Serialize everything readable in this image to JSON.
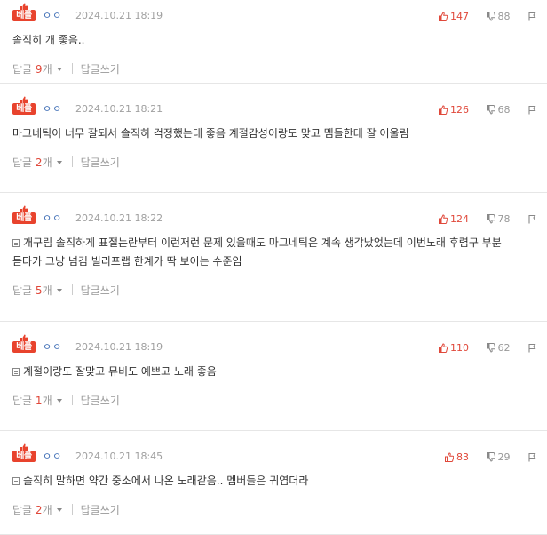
{
  "labels": {
    "best": "베플",
    "reply": "답글",
    "reply_count_suffix": "개",
    "write_reply": "답글쓰기"
  },
  "colors": {
    "best_badge": "#e8432d",
    "like": "#e0483a",
    "nickname": "#3d6db5"
  },
  "comments": [
    {
      "nickname": "ㅇㅇ",
      "date": "2024.10.21 18:19",
      "likes": "147",
      "dislikes": "88",
      "text": "솔직히 개 좋음..",
      "reply_count": "9",
      "has_doc_icon": false
    },
    {
      "nickname": "ㅇㅇ",
      "date": "2024.10.21 18:21",
      "likes": "126",
      "dislikes": "68",
      "text": "마그네틱이 너무 잘되서 솔직히 걱정했는데 좋음 계절감성이랑도 맞고 멤들한테 잘 어울림",
      "reply_count": "2",
      "has_doc_icon": false
    },
    {
      "nickname": "ㅇㅇ",
      "date": "2024.10.21 18:22",
      "likes": "124",
      "dislikes": "78",
      "text": "개구림 솔직하게 표절논란부터 이런저런 문제 있을때도 마그네틱은 계속 생각났었는데 이번노래 후렴구 부분 듣다가 그냥 넘김 빌리프랩 한계가 딱 보이는 수준임",
      "reply_count": "5",
      "has_doc_icon": true
    },
    {
      "nickname": "ㅇㅇ",
      "date": "2024.10.21 18:19",
      "likes": "110",
      "dislikes": "62",
      "text": "계절이랑도 잘맞고 뮤비도 예쁘고 노래 좋음",
      "reply_count": "1",
      "has_doc_icon": true
    },
    {
      "nickname": "ㅇㅇ",
      "date": "2024.10.21 18:45",
      "likes": "83",
      "dislikes": "29",
      "text": "솔직히 말하면 약간 중소에서 나온 노래같음.. 멤버들은 귀엽더라",
      "reply_count": "2",
      "has_doc_icon": true
    }
  ]
}
